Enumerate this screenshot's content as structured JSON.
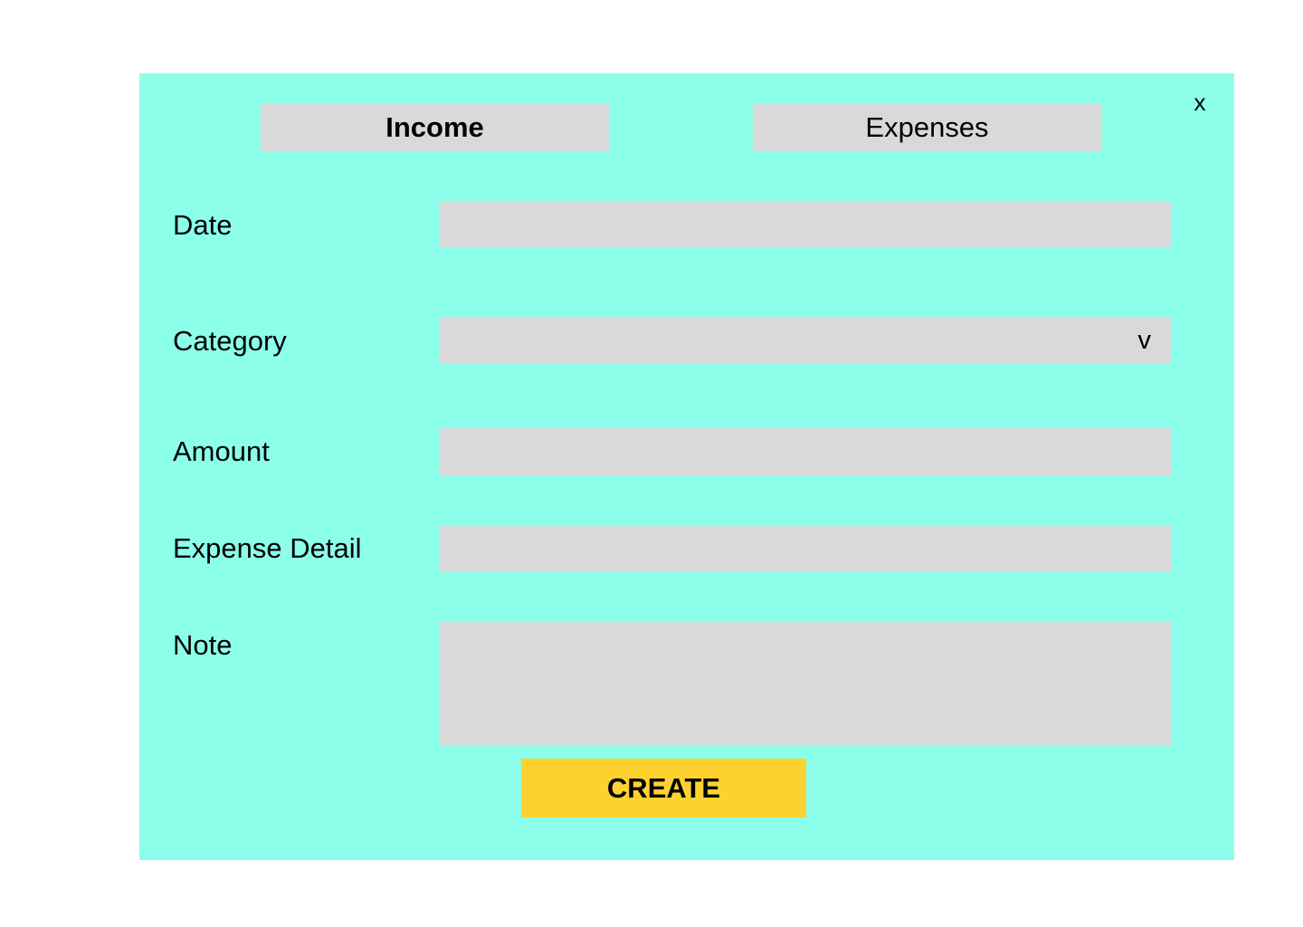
{
  "dialog": {
    "close_label": "x",
    "background_color": "#8cffea"
  },
  "tabs": [
    {
      "label": "Income",
      "active": true
    },
    {
      "label": "Expenses",
      "active": false
    }
  ],
  "form": {
    "date": {
      "label": "Date",
      "value": ""
    },
    "category": {
      "label": "Category",
      "value": "",
      "chevron": "v"
    },
    "amount": {
      "label": "Amount",
      "value": ""
    },
    "expense_detail": {
      "label": "Expense Detail",
      "value": ""
    },
    "note": {
      "label": "Note",
      "value": ""
    }
  },
  "actions": {
    "create_label": "CREATE",
    "create_color": "#fdd22f"
  },
  "colors": {
    "field_background": "#d9d9d9"
  }
}
